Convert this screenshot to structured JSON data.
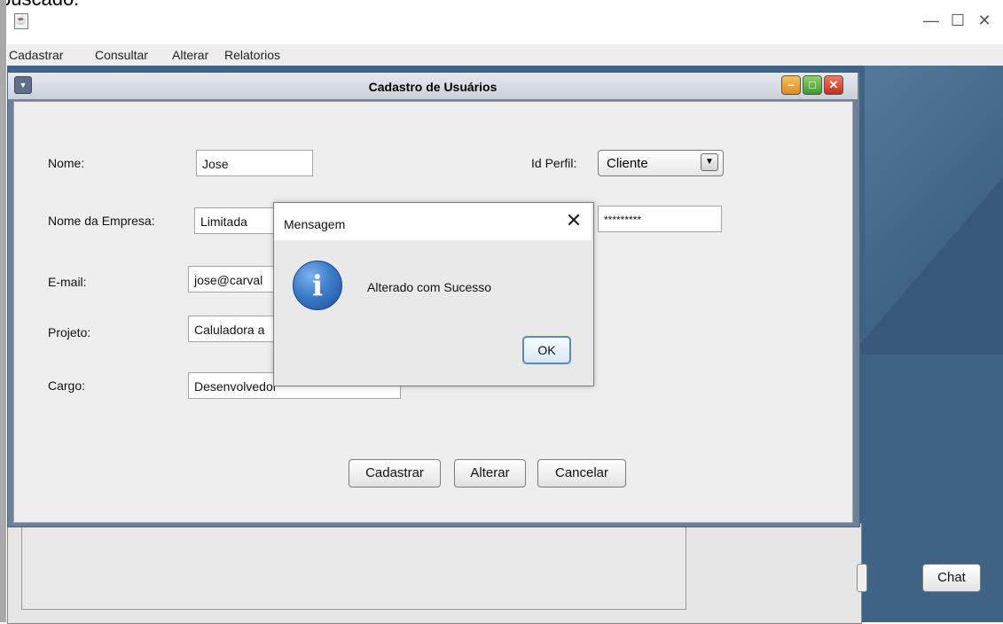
{
  "top_clipped_text": "buscado.",
  "window": {
    "icon": "java-icon",
    "controls": {
      "minimize": "—",
      "maximize": "☐",
      "close": "✕"
    }
  },
  "menubar": [
    "Cadastrar",
    "Consultar",
    "Alterar",
    "Relatorios"
  ],
  "internal_frame": {
    "title": "Cadastro de Usuários",
    "buttons": {
      "minimize": "–",
      "maximize": "□",
      "close": "✕"
    },
    "colors": {
      "minimize": "#f0a030",
      "maximize": "#4fae3a",
      "close": "#dd3b2a"
    }
  },
  "form": {
    "nome_label": "Nome:",
    "nome_value": "Jose",
    "empresa_label": "Nome da Empresa:",
    "empresa_value": "Limitada",
    "email_label": "E-mail:",
    "email_value": "jose@carval",
    "projeto_label": "Projeto:",
    "projeto_value": "Caluladora a",
    "cargo_label": "Cargo:",
    "cargo_value": "Desenvolvedor",
    "perfil_label": "Id Perfil:",
    "perfil_value": "Cliente",
    "senha_value": "*********"
  },
  "buttons": {
    "cadastrar": "Cadastrar",
    "alterar": "Alterar",
    "cancelar": "Cancelar"
  },
  "dialog": {
    "title": "Mensagem",
    "close": "✕",
    "icon": "info-icon",
    "icon_glyph": "i",
    "message": "Alterado com Sucesso",
    "ok": "OK"
  },
  "background": {
    "chat_button": "Chat",
    "desktop_color": "#3f6384"
  }
}
